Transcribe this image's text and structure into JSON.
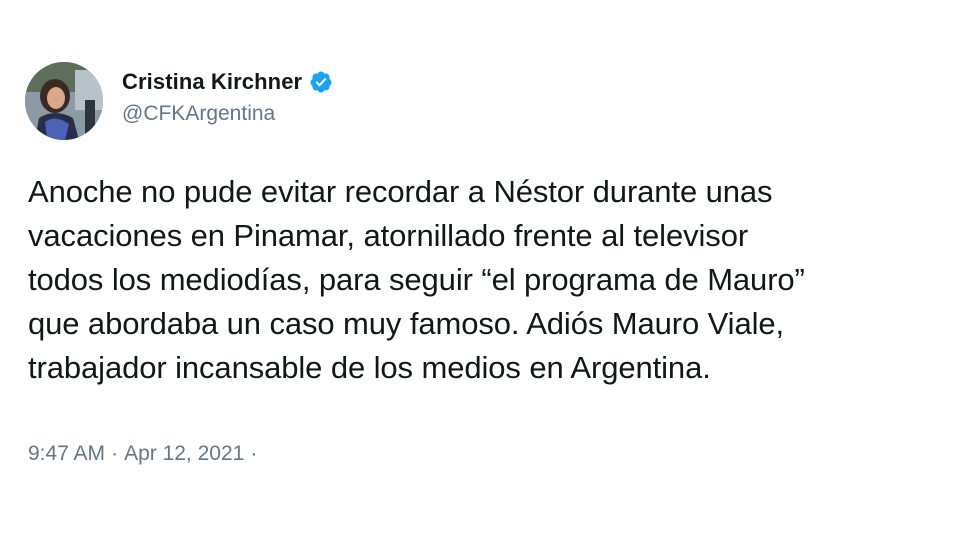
{
  "tweet": {
    "author": {
      "name": "Cristina Kirchner",
      "handle": "@CFKArgentina",
      "verified_icon": "verified-badge-icon"
    },
    "text_lines": [
      "Anoche no pude evitar recordar a Néstor durante unas",
      "vacaciones en Pinamar, atornillado frente al televisor",
      "todos los mediodías, para seguir “el programa de Mauro”",
      "que abordaba un caso muy famoso. Adiós Mauro Viale,",
      "trabajador incansable de los medios en Argentina."
    ],
    "time": "9:47 AM",
    "separator": "·",
    "date": "Apr 12, 2021",
    "trailing_separator": "·"
  },
  "colors": {
    "text": "#14171a",
    "secondary_text": "#657786",
    "verified_blue": "#1da1f2",
    "background": "#ffffff"
  }
}
